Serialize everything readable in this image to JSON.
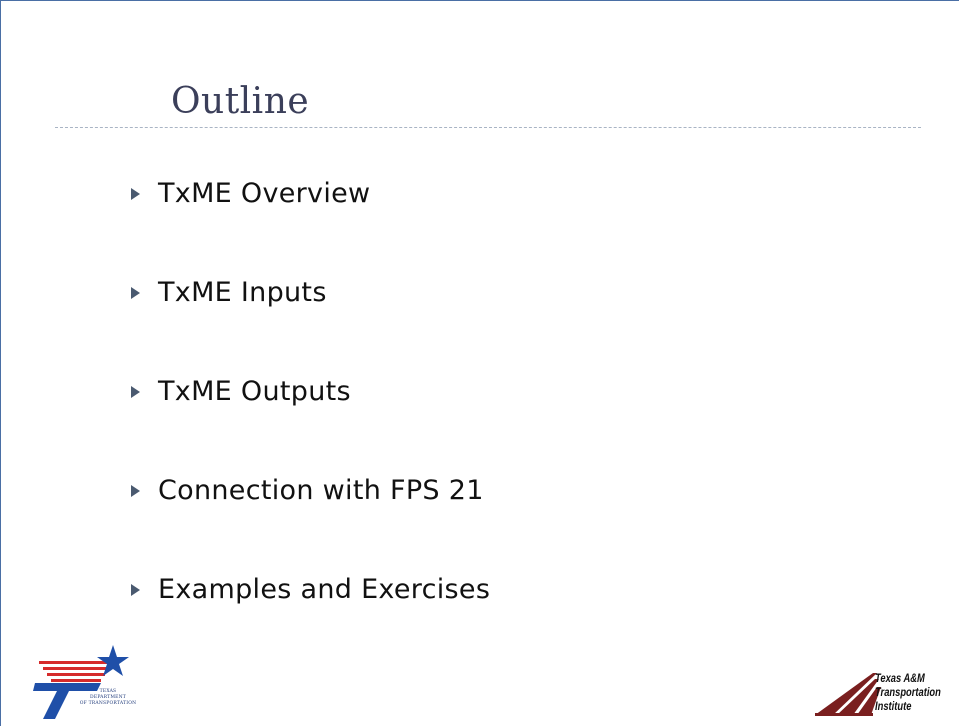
{
  "slide": {
    "title": "Outline",
    "bullets": [
      {
        "label": "TxME Overview"
      },
      {
        "label": "TxME Inputs"
      },
      {
        "label": "TxME Outputs"
      },
      {
        "label": "Connection with FPS 21"
      },
      {
        "label": "Examples and Exercises"
      }
    ]
  },
  "logos": {
    "txdot": {
      "lines": [
        "TEXAS",
        "DEPARTMENT",
        "OF TRANSPORTATION"
      ],
      "colors": {
        "blue": "#1f4fa8",
        "red": "#d62b2b"
      }
    },
    "tti": {
      "lines": [
        "Texas A&M",
        "Transportation",
        "Institute"
      ],
      "colors": {
        "maroon": "#7a1f1f"
      }
    }
  },
  "theme": {
    "title_color": "#3b3f5a",
    "border_color": "#4a6fa5",
    "bullet_marker_color": "#4a5a70"
  }
}
